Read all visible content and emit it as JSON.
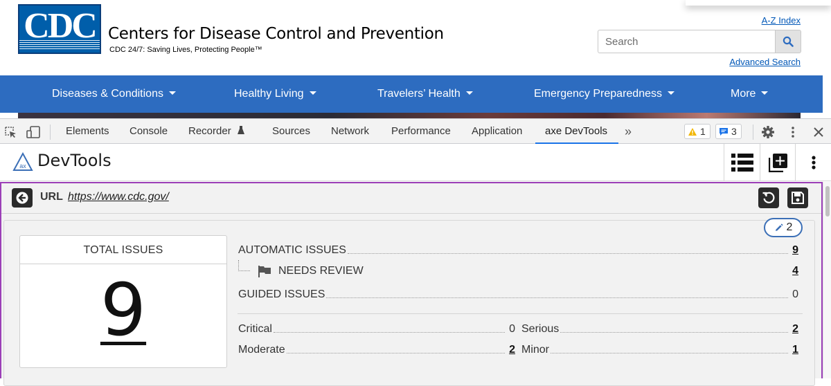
{
  "site": {
    "logo_text": "CDC",
    "title": "Centers for Disease Control and Prevention",
    "tagline": "CDC 24/7: Saving Lives, Protecting People™",
    "az_index": "A-Z Index",
    "search_placeholder": "Search",
    "advanced_search": "Advanced Search",
    "nav": [
      "Diseases & Conditions",
      "Healthy Living",
      "Travelers’ Health",
      "Emergency Preparedness",
      "More"
    ]
  },
  "devtools": {
    "tabs": [
      "Elements",
      "Console",
      "Recorder",
      "Sources",
      "Network",
      "Performance",
      "Application",
      "axe DevTools"
    ],
    "active_tab": "axe DevTools",
    "warnings_count": "1",
    "messages_count": "3"
  },
  "axe": {
    "title": "DevTools",
    "logo_text": "ax",
    "url_label": "URL",
    "url": "https://www.cdc.gov/",
    "pill_count": "2",
    "total_issues_label": "TOTAL ISSUES",
    "total_issues": "9",
    "automatic_issues_label": "AUTOMATIC ISSUES",
    "automatic_issues": "9",
    "needs_review_label": "NEEDS REVIEW",
    "needs_review": "4",
    "guided_issues_label": "GUIDED ISSUES",
    "guided_issues": "0",
    "severity": {
      "critical_label": "Critical",
      "critical": "0",
      "serious_label": "Serious",
      "serious": "2",
      "moderate_label": "Moderate",
      "moderate": "2",
      "minor_label": "Minor",
      "minor": "1"
    }
  },
  "colors": {
    "nav_blue": "#2d6cc0",
    "logo_blue": "#005eaa",
    "link_blue": "#0057b7",
    "panel_border": "#9b3fb7",
    "devtools_active": "#1a73e8",
    "warning": "#f2b600",
    "message": "#1a73e8"
  }
}
